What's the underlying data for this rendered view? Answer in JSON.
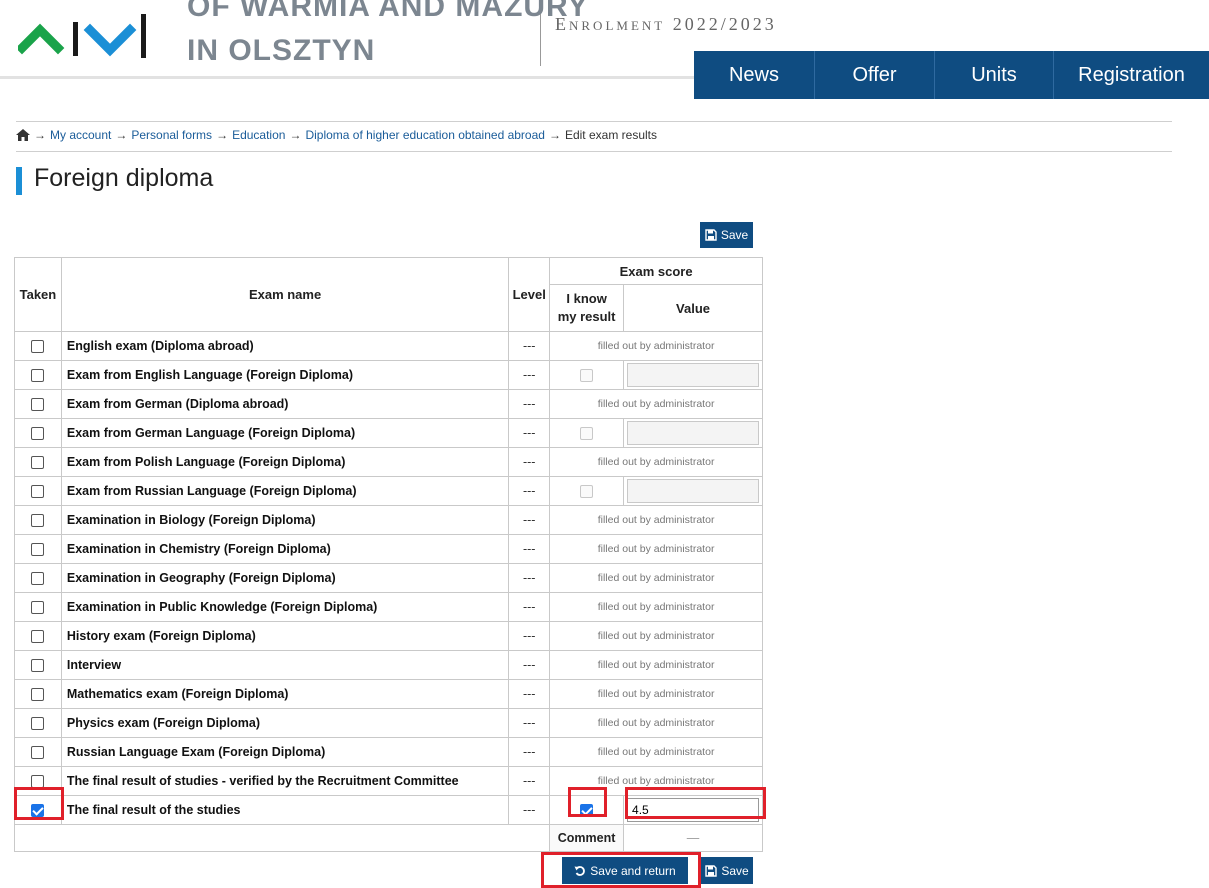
{
  "header": {
    "university_top": "OF WARMIA AND MAZURY",
    "university_bottom": "IN OLSZTYN",
    "enrolment": "Enrolment 2022/2023",
    "nav": [
      "News",
      "Offer",
      "Units",
      "Registration"
    ]
  },
  "breadcrumb": {
    "items": [
      "My account",
      "Personal forms",
      "Education",
      "Diploma of higher education obtained abroad"
    ],
    "current": "Edit exam results",
    "separator": "→"
  },
  "page_title": "Foreign diploma",
  "buttons": {
    "save": "Save",
    "save_and_return": "Save and return"
  },
  "table": {
    "headers": {
      "taken": "Taken",
      "exam_name": "Exam name",
      "level": "Level",
      "exam_score": "Exam score",
      "i_know": "I know my result",
      "value": "Value"
    },
    "admin_note": "filled out by administrator",
    "level_placeholder": "---",
    "rows": [
      {
        "name": "English exam (Diploma abroad)",
        "taken": false,
        "level": "---",
        "mode": "admin"
      },
      {
        "name": "Exam from English Language (Foreign Diploma)",
        "taken": false,
        "level": "---",
        "mode": "input",
        "know": false,
        "value": ""
      },
      {
        "name": "Exam from German (Diploma abroad)",
        "taken": false,
        "level": "---",
        "mode": "admin"
      },
      {
        "name": "Exam from German Language (Foreign Diploma)",
        "taken": false,
        "level": "---",
        "mode": "input",
        "know": false,
        "value": ""
      },
      {
        "name": "Exam from Polish Language (Foreign Diploma)",
        "taken": false,
        "level": "---",
        "mode": "admin"
      },
      {
        "name": "Exam from Russian Language (Foreign Diploma)",
        "taken": false,
        "level": "---",
        "mode": "input",
        "know": false,
        "value": ""
      },
      {
        "name": "Examination in Biology (Foreign Diploma)",
        "taken": false,
        "level": "---",
        "mode": "admin"
      },
      {
        "name": "Examination in Chemistry (Foreign Diploma)",
        "taken": false,
        "level": "---",
        "mode": "admin"
      },
      {
        "name": "Examination in Geography (Foreign Diploma)",
        "taken": false,
        "level": "---",
        "mode": "admin"
      },
      {
        "name": "Examination in Public Knowledge (Foreign Diploma)",
        "taken": false,
        "level": "---",
        "mode": "admin"
      },
      {
        "name": "History exam (Foreign Diploma)",
        "taken": false,
        "level": "---",
        "mode": "admin"
      },
      {
        "name": "Interview",
        "taken": false,
        "level": "---",
        "mode": "admin"
      },
      {
        "name": "Mathematics exam (Foreign Diploma)",
        "taken": false,
        "level": "---",
        "mode": "admin"
      },
      {
        "name": "Physics exam (Foreign Diploma)",
        "taken": false,
        "level": "---",
        "mode": "admin"
      },
      {
        "name": "Russian Language Exam (Foreign Diploma)",
        "taken": false,
        "level": "---",
        "mode": "admin"
      },
      {
        "name": "The final result of studies - verified by the Recruitment Committee",
        "taken": false,
        "level": "---",
        "mode": "admin"
      },
      {
        "name": "The final result of the studies",
        "taken": true,
        "level": "---",
        "mode": "input",
        "know": true,
        "value": "4.5"
      }
    ],
    "comment_label": "Comment",
    "comment_value": "—"
  },
  "colors": {
    "nav_bg": "#0f4c81",
    "accent": "#1b8fd6",
    "logo_green": "#1aa34a",
    "logo_blue": "#1b8fd6",
    "highlight": "#e0202a",
    "checkbox_checked": "#1a73e8"
  }
}
